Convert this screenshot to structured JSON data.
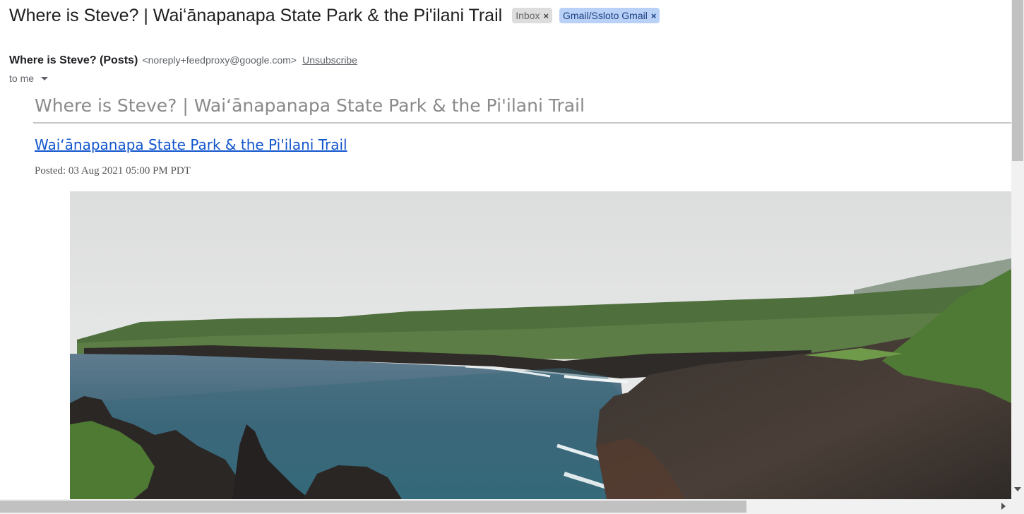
{
  "email": {
    "subject": "Where is Steve? | Waiʻānapanapa State Park & the Pi'ilani Trail",
    "labels": [
      {
        "text": "Inbox",
        "remove_glyph": "×"
      },
      {
        "text": "Gmail/Ssloto Gmail",
        "remove_glyph": "×"
      }
    ],
    "sender": {
      "name": "Where is Steve? (Posts)",
      "email": "<noreply+feedproxy@google.com>",
      "unsubscribe": "Unsubscribe"
    },
    "recipient": "to me"
  },
  "body": {
    "feed_title": "Where is Steve? | Waiʻānapanapa State Park & the Pi'ilani Trail",
    "post_link": "Waiʻānapanapa State Park & the Pi'ilani Trail",
    "posted": "Posted: 03 Aug 2021 05:00 PM PDT"
  },
  "icons": {
    "label_remove": "close-icon",
    "recipient_toggle": "chevron-down-icon"
  },
  "colors": {
    "link": "#1155cc",
    "label_inbox_bg": "#dddddd",
    "label_gmail_bg": "#b9d1f7"
  }
}
